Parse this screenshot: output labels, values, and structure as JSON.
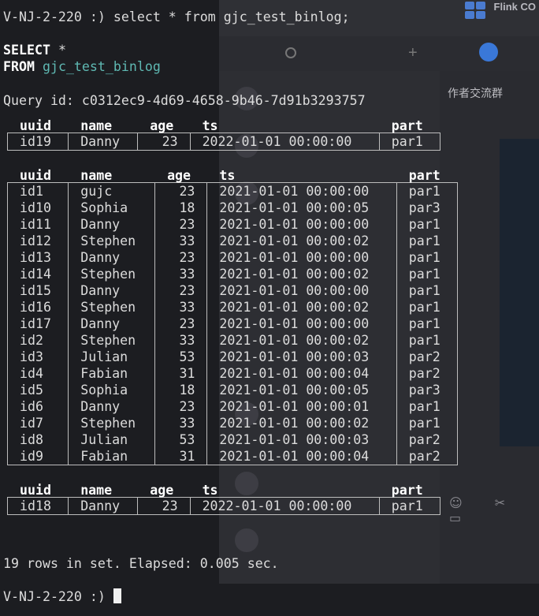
{
  "background_window": {
    "title": "Flink CO",
    "group_title": "作者交流群",
    "tools": "☺ ✂ ▭"
  },
  "terminal": {
    "prompt": "V-NJ-2-220 :)",
    "command": "select * from gjc_test_binlog;",
    "select_kw": "SELECT",
    "select_star": "*",
    "from_kw": "FROM",
    "table_name": "gjc_test_binlog",
    "query_id": "Query id: c0312ec9-4d69-4658-9b46-7d91b3293757",
    "summary": "19 rows in set. Elapsed: 0.005 sec.",
    "final_prompt": "V-NJ-2-220 :)"
  },
  "columns": [
    "uuid",
    "name",
    "age",
    "ts",
    "part"
  ],
  "block1": [
    [
      "id19",
      "Danny",
      "23",
      "2022-01-01 00:00:00",
      "par1"
    ]
  ],
  "block2": [
    [
      "id1",
      "gujc",
      "23",
      "2021-01-01 00:00:00",
      "par1"
    ],
    [
      "id10",
      "Sophia",
      "18",
      "2021-01-01 00:00:05",
      "par3"
    ],
    [
      "id11",
      "Danny",
      "23",
      "2021-01-01 00:00:00",
      "par1"
    ],
    [
      "id12",
      "Stephen",
      "33",
      "2021-01-01 00:00:02",
      "par1"
    ],
    [
      "id13",
      "Danny",
      "23",
      "2021-01-01 00:00:00",
      "par1"
    ],
    [
      "id14",
      "Stephen",
      "33",
      "2021-01-01 00:00:02",
      "par1"
    ],
    [
      "id15",
      "Danny",
      "23",
      "2021-01-01 00:00:00",
      "par1"
    ],
    [
      "id16",
      "Stephen",
      "33",
      "2021-01-01 00:00:02",
      "par1"
    ],
    [
      "id17",
      "Danny",
      "23",
      "2021-01-01 00:00:00",
      "par1"
    ],
    [
      "id2",
      "Stephen",
      "33",
      "2021-01-01 00:00:02",
      "par1"
    ],
    [
      "id3",
      "Julian",
      "53",
      "2021-01-01 00:00:03",
      "par2"
    ],
    [
      "id4",
      "Fabian",
      "31",
      "2021-01-01 00:00:04",
      "par2"
    ],
    [
      "id5",
      "Sophia",
      "18",
      "2021-01-01 00:00:05",
      "par3"
    ],
    [
      "id6",
      "Danny",
      "23",
      "2021-01-01 00:00:01",
      "par1"
    ],
    [
      "id7",
      "Stephen",
      "33",
      "2021-01-01 00:00:02",
      "par1"
    ],
    [
      "id8",
      "Julian",
      "53",
      "2021-01-01 00:00:03",
      "par2"
    ],
    [
      "id9",
      "Fabian",
      "31",
      "2021-01-01 00:00:04",
      "par2"
    ]
  ],
  "block3": [
    [
      "id18",
      "Danny",
      "23",
      "2022-01-01 00:00:00",
      "par1"
    ]
  ]
}
